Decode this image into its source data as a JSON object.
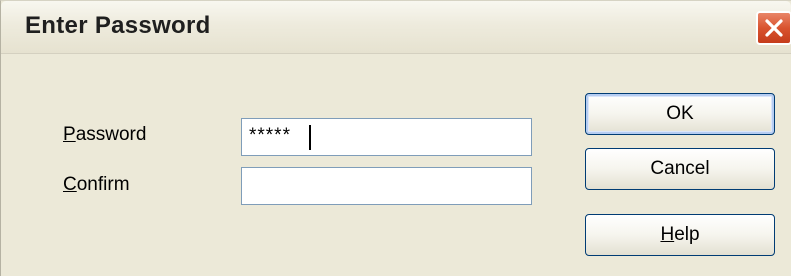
{
  "window": {
    "title": "Enter Password"
  },
  "form": {
    "password": {
      "label_mnemonic": "P",
      "label_rest": "assword",
      "value": "*****"
    },
    "confirm": {
      "label_mnemonic": "C",
      "label_rest": "onfirm",
      "value": ""
    }
  },
  "buttons": {
    "ok": "OK",
    "cancel": "Cancel",
    "help_mnemonic": "H",
    "help_rest": "elp"
  },
  "colors": {
    "dialog_background": "#ece9d8",
    "close_button": "#d9532f",
    "field_border": "#7f9db9",
    "button_border": "#003c74"
  }
}
